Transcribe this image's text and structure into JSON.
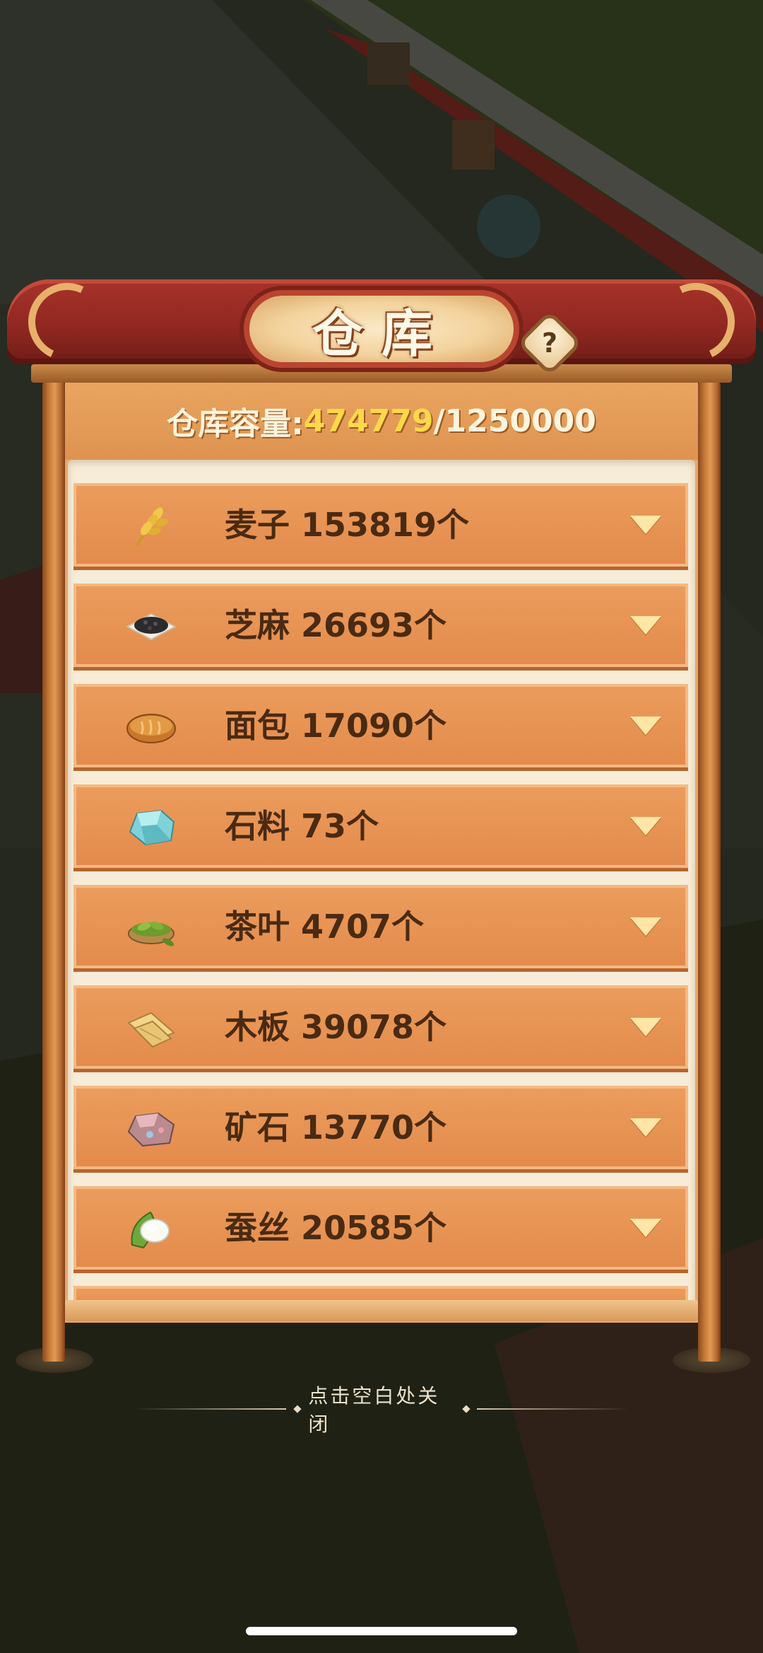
{
  "title": "仓库",
  "help_glyph": "?",
  "capacity": {
    "label": "仓库容量:",
    "current": "474779",
    "separator": "/",
    "max": "1250000",
    "current_color": "#ffd84a"
  },
  "items": [
    {
      "name": "麦子 153819个",
      "icon": "wheat-icon"
    },
    {
      "name": "芝麻 26693个",
      "icon": "sesame-icon"
    },
    {
      "name": "面包 17090个",
      "icon": "bread-icon"
    },
    {
      "name": "石料 73个",
      "icon": "stone-icon"
    },
    {
      "name": "茶叶 4707个",
      "icon": "tea-leaf-icon"
    },
    {
      "name": "木板 39078个",
      "icon": "plank-icon"
    },
    {
      "name": "矿石 13770个",
      "icon": "ore-icon"
    },
    {
      "name": "蚕丝 20585个",
      "icon": "silk-cocoon-icon"
    }
  ],
  "close_hint": "点击空白处关闭"
}
